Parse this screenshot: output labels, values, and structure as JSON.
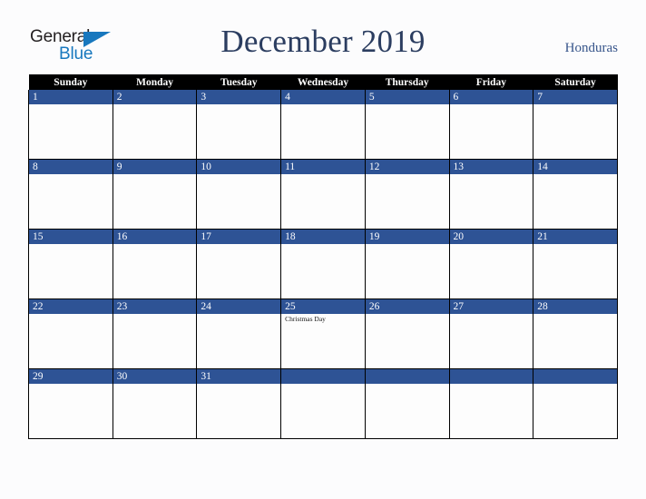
{
  "brand": {
    "name_part1": "General",
    "name_part2": "Blue",
    "triangle_icon": "triangle-icon",
    "color_dark": "#231f20",
    "color_blue": "#1878be"
  },
  "header": {
    "title": "December 2019",
    "country": "Honduras",
    "title_color": "#2b3d60",
    "country_color": "#36548a"
  },
  "calendar": {
    "weekday_headers": [
      "Sunday",
      "Monday",
      "Tuesday",
      "Wednesday",
      "Thursday",
      "Friday",
      "Saturday"
    ],
    "header_bg": "#000000",
    "header_text_color": "#ffffff",
    "daybar_bg": "#2e5395",
    "daybar_text_color": "#ffffff",
    "cell_bg": "#fdfdfd",
    "border_color": "#000000",
    "weeks": [
      [
        {
          "day": "1",
          "events": []
        },
        {
          "day": "2",
          "events": []
        },
        {
          "day": "3",
          "events": []
        },
        {
          "day": "4",
          "events": []
        },
        {
          "day": "5",
          "events": []
        },
        {
          "day": "6",
          "events": []
        },
        {
          "day": "7",
          "events": []
        }
      ],
      [
        {
          "day": "8",
          "events": []
        },
        {
          "day": "9",
          "events": []
        },
        {
          "day": "10",
          "events": []
        },
        {
          "day": "11",
          "events": []
        },
        {
          "day": "12",
          "events": []
        },
        {
          "day": "13",
          "events": []
        },
        {
          "day": "14",
          "events": []
        }
      ],
      [
        {
          "day": "15",
          "events": []
        },
        {
          "day": "16",
          "events": []
        },
        {
          "day": "17",
          "events": []
        },
        {
          "day": "18",
          "events": []
        },
        {
          "day": "19",
          "events": []
        },
        {
          "day": "20",
          "events": []
        },
        {
          "day": "21",
          "events": []
        }
      ],
      [
        {
          "day": "22",
          "events": []
        },
        {
          "day": "23",
          "events": []
        },
        {
          "day": "24",
          "events": []
        },
        {
          "day": "25",
          "events": [
            "Christmas Day"
          ]
        },
        {
          "day": "26",
          "events": []
        },
        {
          "day": "27",
          "events": []
        },
        {
          "day": "28",
          "events": []
        }
      ],
      [
        {
          "day": "29",
          "events": []
        },
        {
          "day": "30",
          "events": []
        },
        {
          "day": "31",
          "events": []
        },
        {
          "day": "",
          "events": []
        },
        {
          "day": "",
          "events": []
        },
        {
          "day": "",
          "events": []
        },
        {
          "day": "",
          "events": []
        }
      ]
    ]
  }
}
